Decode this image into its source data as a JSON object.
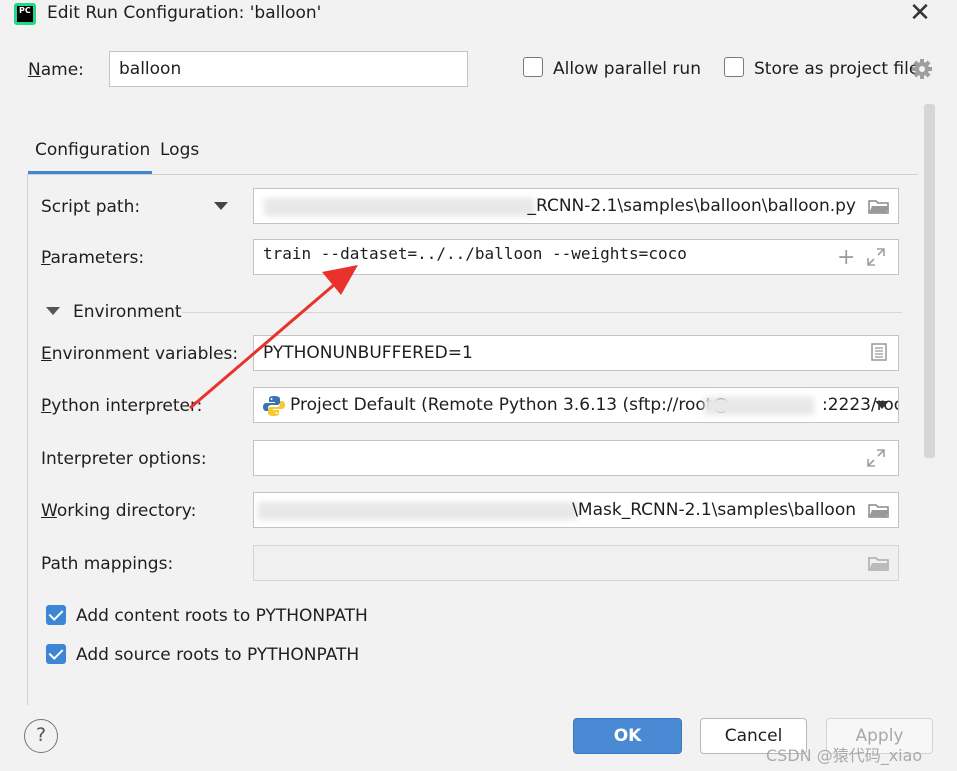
{
  "window": {
    "title": "Edit Run Configuration: 'balloon'",
    "app_icon_text": "PC"
  },
  "header": {
    "name_label": "Name:",
    "name_value": "balloon",
    "allow_parallel_label": "Allow parallel run",
    "allow_parallel_checked": false,
    "store_project_label": "Store as project file",
    "store_project_checked": false
  },
  "tabs": [
    {
      "label": "Configuration",
      "active": true
    },
    {
      "label": "Logs",
      "active": false
    }
  ],
  "form": {
    "script_path_label": "Script path:",
    "script_path_value": "_RCNN-2.1\\samples\\balloon\\balloon.py",
    "parameters_label": "Parameters:",
    "parameters_value": "train --dataset=../../balloon --weights=coco",
    "environment_section": "Environment",
    "env_vars_label": "Environment variables:",
    "env_vars_value": "PYTHONUNBUFFERED=1",
    "interpreter_label": "Python interpreter:",
    "interpreter_value_left": "Project Default (Remote Python 3.6.13 (sftp://root@",
    "interpreter_value_right": ":2223/roo",
    "interpreter_options_label": "Interpreter options:",
    "interpreter_options_value": "",
    "working_dir_label": "Working directory:",
    "working_dir_value": "\\Mask_RCNN-2.1\\samples\\balloon",
    "path_mappings_label": "Path mappings:",
    "path_mappings_value": "",
    "content_roots_label": "Add content roots to PYTHONPATH",
    "content_roots_checked": true,
    "source_roots_label": "Add source roots to PYTHONPATH",
    "source_roots_checked": true
  },
  "footer": {
    "help_label": "?",
    "ok_label": "OK",
    "cancel_label": "Cancel",
    "apply_label": "Apply"
  },
  "watermark": "CSDN @猿代码_xiao",
  "colors": {
    "accent": "#3d86d6",
    "annotation_arrow": "#e8322b",
    "ok_button": "#4a8ad4"
  }
}
